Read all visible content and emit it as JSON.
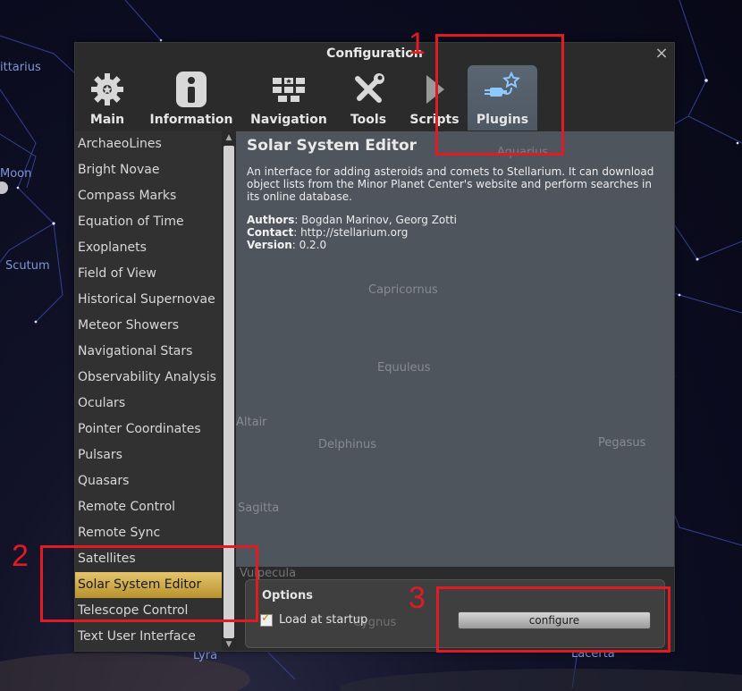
{
  "dialog": {
    "title": "Configuration",
    "close_glyph": "×",
    "tabs": [
      {
        "label": "Main",
        "icon": "gear-icon"
      },
      {
        "label": "Information",
        "icon": "info-icon"
      },
      {
        "label": "Navigation",
        "icon": "keyboard-icon"
      },
      {
        "label": "Tools",
        "icon": "tools-icon"
      },
      {
        "label": "Scripts",
        "icon": "play-icon"
      },
      {
        "label": "Plugins",
        "icon": "plug-star-icon",
        "active": true
      }
    ]
  },
  "plugins": {
    "items": [
      "ArchaeoLines",
      "Bright Novae",
      "Compass Marks",
      "Equation of Time",
      "Exoplanets",
      "Field of View",
      "Historical Supernovae",
      "Meteor Showers",
      "Navigational Stars",
      "Observability Analysis",
      "Oculars",
      "Pointer Coordinates",
      "Pulsars",
      "Quasars",
      "Remote Control",
      "Remote Sync",
      "Satellites",
      "Solar System Editor",
      "Telescope Control",
      "Text User Interface"
    ],
    "selected": "Solar System Editor"
  },
  "details": {
    "title": "Solar System Editor",
    "description": "An interface for adding asteroids and comets to Stellarium. It can download object lists from the Minor Planet Center's website and perform searches in its online database.",
    "authors_label": "Authors",
    "authors": ": Bogdan Marinov, Georg Zotti",
    "contact_label": "Contact",
    "contact": ": http://stellarium.org",
    "version_label": "Version",
    "version": ": 0.2.0"
  },
  "options": {
    "title": "Options",
    "load_at_startup_label": "Load at startup",
    "load_at_startup_checked": true,
    "configure_label": "configure"
  },
  "sky_labels": {
    "sagittarius": "ittarius",
    "moon": "Moon",
    "scutum": "Scutum",
    "capricornus": "Capricornus",
    "aquarius": "Aquarius",
    "equuleus": "Equuleus",
    "altair": "Altair",
    "delphinus": "Delphinus",
    "pegasus": "Pegasus",
    "sagitta": "Sagitta",
    "vulpecula": "Vulpecula",
    "cygnus": "Cygnus",
    "lyra": "Lyra",
    "lacerta": "Lacerta"
  },
  "annotations": {
    "one": "1",
    "two": "2",
    "three": "3",
    "color": "#e01b24"
  }
}
